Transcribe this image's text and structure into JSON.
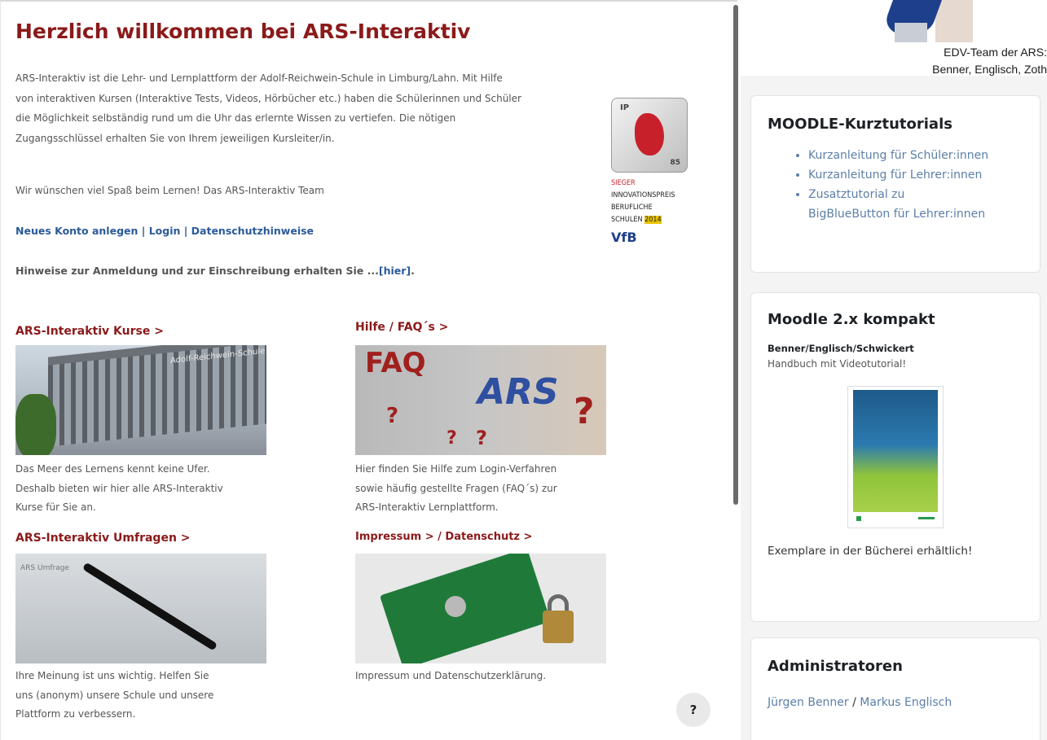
{
  "main": {
    "title": "Herzlich willkommen bei ARS-Interaktiv",
    "intro_lines": [
      "ARS-Interaktiv ist die Lehr- und Lernplattform der Adolf-Reichwein-Schule in Limburg/Lahn. Mit Hilfe",
      "von interaktiven Kursen (Interaktive Tests, Videos, Hörbücher etc.) haben die Schülerinnen und Schüler",
      "die Möglichkeit selbständig rund um die Uhr das erlernte Wissen zu vertiefen. Die nötigen",
      "Zugangsschlüssel erhalten Sie von Ihrem jeweiligen Kursleiter/in."
    ],
    "greeting": "Wir wünschen viel Spaß beim Lernen! Das ARS-Interaktiv Team",
    "links": {
      "new_account": "Neues Konto anlegen",
      "login": "Login",
      "privacy": "Datenschutzhinweise",
      "sep": " | "
    },
    "hint_prefix": "Hinweise zur Anmeldung und zur Einschreibung erhalten Sie ...",
    "hint_link": "[hier]",
    "hint_suffix": ".",
    "award": {
      "ip": "IP",
      "year_small": "85",
      "line1": "SIEGER",
      "line2": "INNOVATIONSPREIS",
      "line3": "BERUFLICHE",
      "line4a": "SCHULEN",
      "line4b": "2014",
      "logo": "VfB"
    },
    "tiles": [
      {
        "heading": "ARS-Interaktiv Kurse >",
        "image_label": "Adolf-Reichwein-Schule",
        "desc": [
          "Das Meer des Lernens kennt keine Ufer.",
          "Deshalb bieten wir hier alle ARS-Interaktiv",
          "Kurse für Sie an."
        ]
      },
      {
        "heading": "Hilfe / FAQ´s >",
        "image_faq": "FAQ",
        "image_ars": "ARS",
        "image_q": "?",
        "desc": [
          "Hier finden Sie Hilfe zum Login-Verfahren",
          "sowie häufig gestellte Fragen (FAQ´s) zur",
          "ARS-Interaktiv Lernplattform."
        ]
      },
      {
        "heading": "ARS-Interaktiv Umfragen >",
        "image_label": "ARS Umfrage",
        "desc": [
          "Ihre Meinung ist uns wichtig. Helfen Sie",
          "uns (anonym) unsere Schule und unsere",
          "Plattform zu verbessern."
        ]
      },
      {
        "heading": "Impressum > / Datenschutz >",
        "desc": [
          "Impressum und Datenschutzerklärung."
        ]
      }
    ],
    "help_label": "?"
  },
  "sidebar": {
    "edv_line1": "EDV-Team der ARS:",
    "edv_line2": "Benner, Englisch, Zoth",
    "tutorials": {
      "title": "MOODLE-Kurztutorials",
      "items": [
        "Kurzanleitung für Schüler:innen",
        "Kurzanleitung für Lehrer:innen",
        "Zusatztutorial zu",
        "BigBlueButton für Lehrer:innen"
      ]
    },
    "book": {
      "title": "Moodle 2.x kompakt",
      "authors": "Benner/Englisch/Schwickert",
      "subtitle": "Handbuch mit Videotutorial!",
      "footer": "Exemplare in der Bücherei erhältlich!"
    },
    "admins": {
      "title": "Administratoren",
      "name1": "Jürgen Benner",
      "sep": " / ",
      "name2": "Markus Englisch"
    }
  }
}
